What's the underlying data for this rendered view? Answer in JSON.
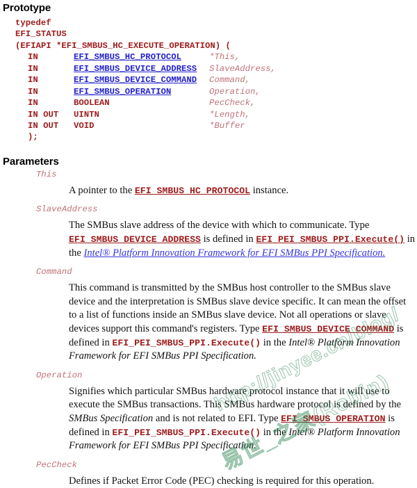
{
  "document": {
    "sections": {
      "prototype_heading": "Prototype",
      "parameters_heading": "Parameters"
    },
    "prototype": {
      "lines": [
        {
          "kind": "plain",
          "text": "typedef"
        },
        {
          "kind": "plain",
          "text": "EFI_STATUS"
        },
        {
          "kind": "plain",
          "text": "(EFIAPI *EFI_SMBUS_HC_EXECUTE_OPERATION) ("
        },
        {
          "kind": "param",
          "direction": "IN",
          "type": "EFI_SMBUS_HC_PROTOCOL",
          "type_is_link": true,
          "variable": "*This,"
        },
        {
          "kind": "param",
          "direction": "IN",
          "type": "EFI_SMBUS_DEVICE_ADDRESS",
          "type_is_link": true,
          "variable": "SlaveAddress,"
        },
        {
          "kind": "param",
          "direction": "IN",
          "type": "EFI_SMBUS_DEVICE_COMMAND",
          "type_is_link": true,
          "variable": "Command,"
        },
        {
          "kind": "param",
          "direction": "IN",
          "type": "EFI_SMBUS_OPERATION",
          "type_is_link": true,
          "variable": "Operation,"
        },
        {
          "kind": "param",
          "direction": "IN",
          "type": "BOOLEAN",
          "type_is_link": false,
          "variable": "PecCheck,"
        },
        {
          "kind": "param",
          "direction": "IN OUT",
          "type": "UINTN",
          "type_is_link": false,
          "variable": "*Length,"
        },
        {
          "kind": "param",
          "direction": "IN OUT",
          "type": "VOID",
          "type_is_link": false,
          "variable": "*Buffer"
        },
        {
          "kind": "close",
          "text": ");"
        }
      ]
    },
    "parameters": [
      {
        "name": "This",
        "description_parts": [
          {
            "t": "text",
            "v": "A pointer to the "
          },
          {
            "t": "code",
            "v": "EFI_SMBUS_HC_PROTOCOL"
          },
          {
            "t": "text",
            "v": " instance."
          }
        ]
      },
      {
        "name": "SlaveAddress",
        "description_parts": [
          {
            "t": "text",
            "v": "The SMBus slave address of the device with which to communicate. Type "
          },
          {
            "t": "code",
            "v": "EFI_SMBUS_DEVICE_ADDRESS"
          },
          {
            "t": "text",
            "v": " is defined in "
          },
          {
            "t": "code",
            "v": "EFI_PEI_SMBUS_PPI.Execute()"
          },
          {
            "t": "text",
            "v": " in the "
          },
          {
            "t": "speclink",
            "v": "Intel® Platform Innovation Framework for EFI SMBus PPI Specification."
          }
        ]
      },
      {
        "name": "Command",
        "description_parts": [
          {
            "t": "text",
            "v": "This command is transmitted by the SMBus host controller to the SMBus slave device and the interpretation is SMBus slave device specific. It can mean the offset to a list of functions inside an SMBus slave device. Not all operations or slave devices support this command's registers. Type "
          },
          {
            "t": "code",
            "v": "EFI_SMBUS_DEVICE_COMMAND"
          },
          {
            "t": "text",
            "v": " is defined in "
          },
          {
            "t": "code-plain",
            "v": "EFI_PEI_SMBUS_PPI.Execute()"
          },
          {
            "t": "text",
            "v": " in the "
          },
          {
            "t": "bookref",
            "v": "Intel® Platform Innovation Framework for EFI SMBus PPI Specification."
          }
        ]
      },
      {
        "name": "Operation",
        "description_parts": [
          {
            "t": "text",
            "v": "Signifies which particular SMBus hardware protocol instance that it will use to execute the SMBus transactions. This SMBus hardware protocol is defined by the "
          },
          {
            "t": "bookref",
            "v": "SMBus Specification"
          },
          {
            "t": "text",
            "v": " and is not related to EFI. Type "
          },
          {
            "t": "code",
            "v": "EFI_SMBUS_OPERATION"
          },
          {
            "t": "text",
            "v": " is defined in "
          },
          {
            "t": "code-plain",
            "v": "EFI_PEI_SMBUS_PPI.Execute()"
          },
          {
            "t": "text",
            "v": " in the "
          },
          {
            "t": "bookref",
            "v": "Intel® Platform Innovation Framework for EFI SMBus PPI Specification."
          }
        ]
      },
      {
        "name": "PecCheck",
        "description_parts": [
          {
            "t": "text",
            "v": "Defines if Packet Error Code (PEC) checking is required for this operation."
          }
        ]
      }
    ],
    "watermark": {
      "url_text": "http://jinyee.cn/blog/",
      "secondary_text": "易世_之家(Robin)"
    },
    "colors": {
      "code_red": "#9e1b1b",
      "type_link_blue": "#2222cc",
      "variable_rose": "#c0727a",
      "spec_link_blue": "#3333dd",
      "watermark_green": "#3c8c5f",
      "body_text": "#111111"
    }
  }
}
